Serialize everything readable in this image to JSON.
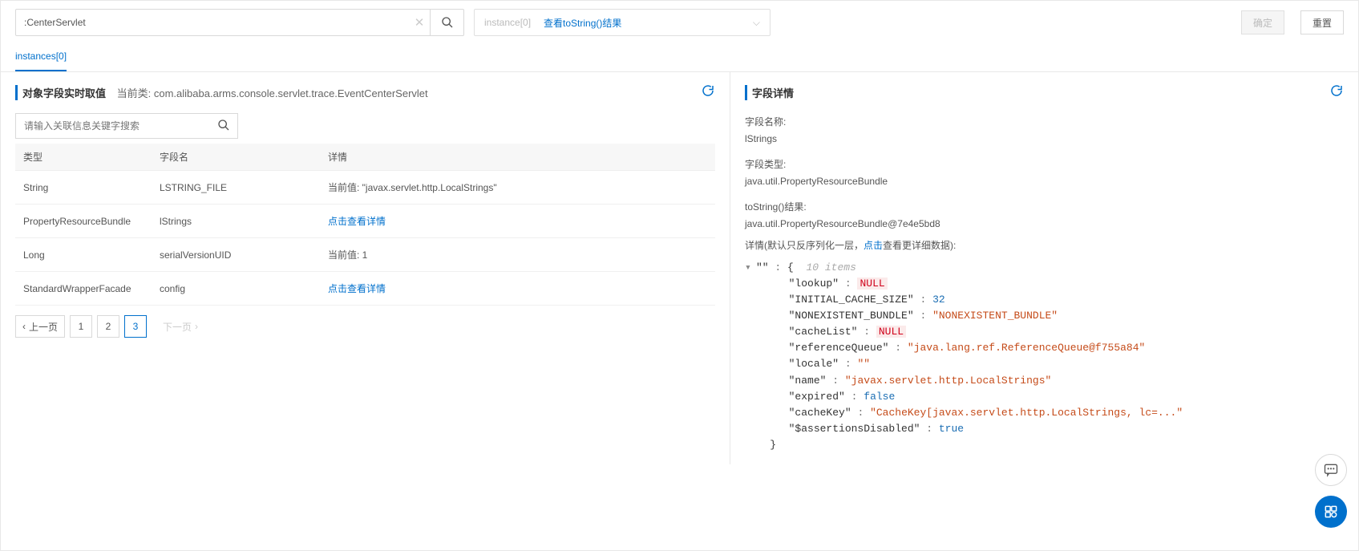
{
  "topbar": {
    "search_value": ":CenterServlet",
    "confirm_label": "确定",
    "reset_label": "重置"
  },
  "instance_selector": {
    "label": "instance[0]",
    "link_text": "查看toString()结果"
  },
  "tabs": {
    "active": "instances[0]"
  },
  "left": {
    "title": "对象字段实时取值",
    "class_prefix": "当前类: ",
    "class_name": "com.alibaba.arms.console.servlet.trace.EventCenterServlet",
    "search_placeholder": "请输入关联信息关键字搜索",
    "columns": {
      "type": "类型",
      "field": "字段名",
      "detail": "详情"
    },
    "rows": [
      {
        "type": "String",
        "field": "LSTRING_FILE",
        "detail_text": "当前值: \"javax.servlet.http.LocalStrings\"",
        "is_link": false
      },
      {
        "type": "PropertyResourceBundle",
        "field": "lStrings",
        "detail_text": "点击查看详情",
        "is_link": true
      },
      {
        "type": "Long",
        "field": "serialVersionUID",
        "detail_text": "当前值: 1",
        "is_link": false
      },
      {
        "type": "StandardWrapperFacade",
        "field": "config",
        "detail_text": "点击查看详情",
        "is_link": true
      }
    ],
    "pager": {
      "prev": "上一页",
      "next": "下一页",
      "pages": [
        "1",
        "2",
        "3"
      ],
      "current": "3"
    }
  },
  "right": {
    "title": "字段详情",
    "field_name_label": "字段名称:",
    "field_name_value": "lStrings",
    "field_type_label": "字段类型:",
    "field_type_value": "java.util.PropertyResourceBundle",
    "tostring_label": "toString()结果:",
    "tostring_value": "java.util.PropertyResourceBundle@7e4e5bd8",
    "detail_label_prefix": "详情(默认只反序列化一层，",
    "detail_label_link": "点击",
    "detail_label_suffix": "查看更详细数据):",
    "json_meta": "10 items",
    "json": [
      {
        "key": "lookup",
        "kind": "null",
        "display": "NULL"
      },
      {
        "key": "INITIAL_CACHE_SIZE",
        "kind": "num",
        "display": "32"
      },
      {
        "key": "NONEXISTENT_BUNDLE",
        "kind": "str",
        "display": "\"NONEXISTENT_BUNDLE\""
      },
      {
        "key": "cacheList",
        "kind": "null",
        "display": "NULL"
      },
      {
        "key": "referenceQueue",
        "kind": "str",
        "display": "\"java.lang.ref.ReferenceQueue@f755a84\""
      },
      {
        "key": "locale",
        "kind": "str",
        "display": "\"\""
      },
      {
        "key": "name",
        "kind": "str",
        "display": "\"javax.servlet.http.LocalStrings\""
      },
      {
        "key": "expired",
        "kind": "bool",
        "display": "false"
      },
      {
        "key": "cacheKey",
        "kind": "str",
        "display": "\"CacheKey[javax.servlet.http.LocalStrings, lc=...\""
      },
      {
        "key": "$assertionsDisabled",
        "kind": "bool",
        "display": "true"
      }
    ]
  }
}
